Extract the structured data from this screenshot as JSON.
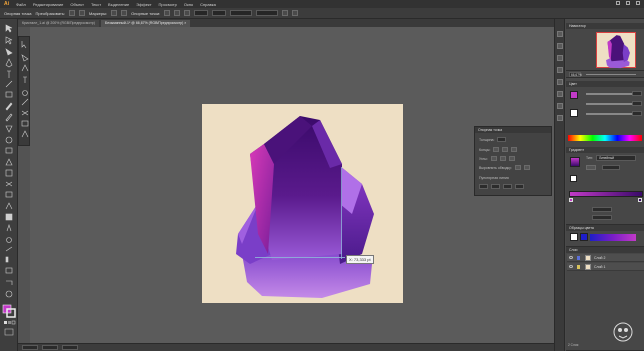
{
  "menu": {
    "logo": "Ai",
    "items": [
      "Файл",
      "Редактирование",
      "Объект",
      "Текст",
      "Выделение",
      "Эффект",
      "Просмотр",
      "Окно",
      "Справка"
    ]
  },
  "control": {
    "label_selection": "Опорная точка",
    "label_convert": "Преобразовать:",
    "label_handles": "Маркеры:",
    "label_anchor": "Опорные точки:"
  },
  "tabs": [
    {
      "label": "Кристалл_1.ai @ 200% (RGB/Предпросмотр)",
      "active": false
    },
    {
      "label": "Безымянный-1* @ 66,67% (RGB/Предпросмотр) ×",
      "active": true
    }
  ],
  "canvas": {
    "readout": "X: 73,333 pt",
    "artboard_color": "#eedfc4"
  },
  "float_panel": {
    "title": "Опорная точка",
    "rows": [
      "Толщина:",
      "Концы:",
      "Углы:",
      "Выровнять обводку:"
    ],
    "section": "Пунктирная линия"
  },
  "dock": {
    "navigator_title": "Навигатор",
    "zoom_value": "66,67%",
    "color_title": "Цвет",
    "gradient_title": "Градиент",
    "gradient_type_label": "Тип:",
    "gradient_type_value": "Линейный",
    "swatch_title": "Образцы цвета",
    "layers_title": "Слои",
    "layers": [
      {
        "name": "Слой 2"
      },
      {
        "name": "Слой 1"
      }
    ],
    "layers_count": "2 Слоя"
  },
  "colors": {
    "accent": "#c23ac8",
    "crystal_dark": "#3a0a6a",
    "crystal_light": "#c06be0",
    "ui_bg": "#535353"
  }
}
